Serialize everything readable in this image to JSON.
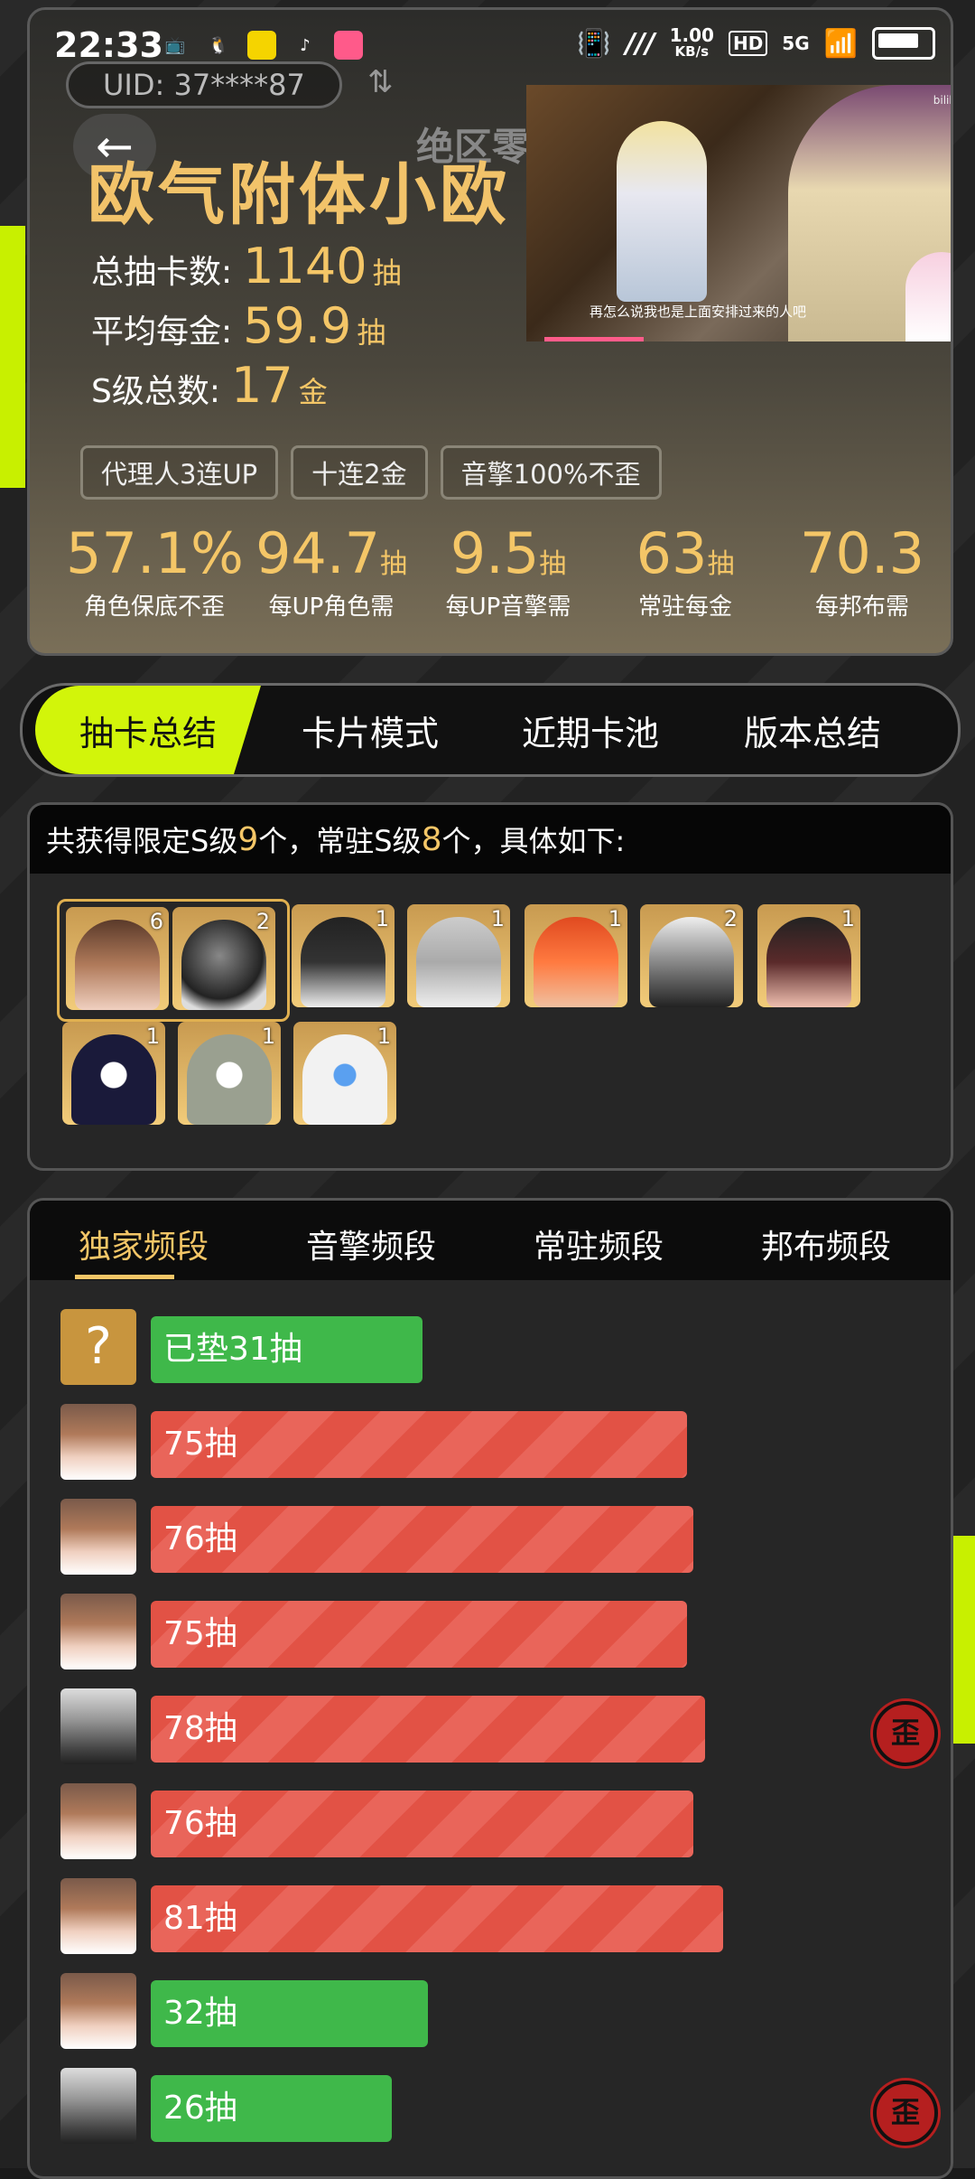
{
  "status_bar": {
    "time": "22:33",
    "net_speed_value": "1.00",
    "net_speed_unit": "KB/s",
    "hd": "HD",
    "signal": "5G"
  },
  "header": {
    "uid": "UID: 37****87",
    "sort_icon": "⇅",
    "server_tag": "绝区零",
    "title": "欧气附体小欧",
    "total_pulls_label": "总抽卡数:",
    "total_pulls_value": "1140",
    "total_pulls_unit": "抽",
    "avg_per_gold_label": "平均每金:",
    "avg_per_gold_value": "59.9",
    "avg_per_gold_unit": "抽",
    "s_total_label": "S级总数:",
    "s_total_value": "17",
    "s_total_unit": "金",
    "tags": [
      "代理人3连UP",
      "十连2金",
      "音擎100%不歪"
    ],
    "metrics": [
      {
        "value": "57.1%",
        "unit": "",
        "label": "角色保底不歪"
      },
      {
        "value": "94.7",
        "unit": "抽",
        "label": "每UP角色需"
      },
      {
        "value": "9.5",
        "unit": "抽",
        "label": "每UP音擎需"
      },
      {
        "value": "63",
        "unit": "抽",
        "label": "常驻每金"
      },
      {
        "value": "70.3",
        "unit": "",
        "label": "每邦布需"
      }
    ],
    "video_subtitle": "再怎么说我也是上面安排过来的人吧",
    "video_brand": "bilibili"
  },
  "nav_tabs": [
    "抽卡总结",
    "卡片模式",
    "近期卡池",
    "版本总结"
  ],
  "summary": {
    "prefix": "共获得限定S级",
    "limited_count": "9",
    "middle": "个，常驻S级",
    "standard_count": "8",
    "suffix": "个，具体如下:",
    "cards": [
      {
        "count": "6",
        "icon": "character-brown-hair-icon"
      },
      {
        "count": "2",
        "icon": "engine-orb-icon"
      },
      {
        "count": "1",
        "icon": "character-black-hair-icon"
      },
      {
        "count": "1",
        "icon": "character-silver-hair-icon"
      },
      {
        "count": "1",
        "icon": "character-red-hair-icon"
      },
      {
        "count": "2",
        "icon": "character-white-hair-icon"
      },
      {
        "count": "1",
        "icon": "character-twin-tail-icon"
      },
      {
        "count": "1",
        "icon": "bangboo-dark-icon"
      },
      {
        "count": "1",
        "icon": "bangboo-grey-icon"
      },
      {
        "count": "1",
        "icon": "bangboo-white-icon"
      }
    ]
  },
  "freq_tabs": [
    "独家频段",
    "音擎频段",
    "常驻频段",
    "邦布频段"
  ],
  "pull_rows": [
    {
      "label": "已垫31抽",
      "pulls": 31,
      "color": "green",
      "avatar": "question",
      "lost": false,
      "question": "?"
    },
    {
      "label": "75抽",
      "pulls": 75,
      "color": "red",
      "avatar": "girl",
      "lost": false
    },
    {
      "label": "76抽",
      "pulls": 76,
      "color": "red",
      "avatar": "girl",
      "lost": false
    },
    {
      "label": "75抽",
      "pulls": 75,
      "color": "red",
      "avatar": "girl",
      "lost": false
    },
    {
      "label": "78抽",
      "pulls": 78,
      "color": "red",
      "avatar": "white",
      "lost": true
    },
    {
      "label": "76抽",
      "pulls": 76,
      "color": "red",
      "avatar": "girl",
      "lost": false
    },
    {
      "label": "81抽",
      "pulls": 81,
      "color": "red",
      "avatar": "girl",
      "lost": false
    },
    {
      "label": "32抽",
      "pulls": 32,
      "color": "green",
      "avatar": "girl",
      "lost": false
    },
    {
      "label": "26抽",
      "pulls": 26,
      "color": "green",
      "avatar": "white",
      "lost": true
    }
  ],
  "lost_badge": "歪"
}
